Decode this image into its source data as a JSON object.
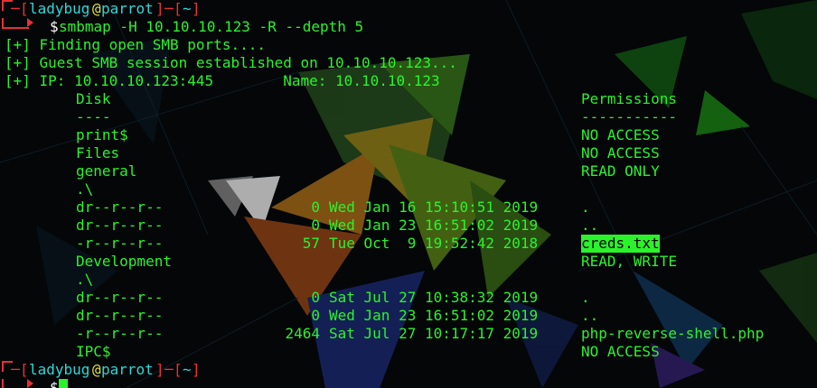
{
  "prompt": {
    "user": "ladybug",
    "at": "@",
    "host": "parrot",
    "dir": "~",
    "bracket_open": "[",
    "bracket_close": "]",
    "dash": "─",
    "dollar": "$"
  },
  "command": "smbmap -H 10.10.10.123 -R --depth 5",
  "info": [
    "[+] Finding open SMB ports....",
    "[+] Guest SMB session established on 10.10.10.123...",
    "[+] IP: 10.10.10.123:445        Name: 10.10.10.123"
  ],
  "table": {
    "header": {
      "disk": "Disk",
      "permissions": "Permissions"
    },
    "rule": {
      "disk": "----",
      "permissions": "-----------"
    },
    "rows": [
      {
        "kind": "share",
        "name": "print$",
        "perm": "NO ACCESS"
      },
      {
        "kind": "share",
        "name": "Files",
        "perm": "NO ACCESS"
      },
      {
        "kind": "share",
        "name": "general",
        "perm": "READ ONLY"
      },
      {
        "kind": "path",
        "name": ".\\"
      },
      {
        "kind": "entry",
        "mode": "dr--r--r--",
        "size": "0",
        "date": "Wed Jan 16 15:10:51 2019",
        "file": "."
      },
      {
        "kind": "entry",
        "mode": "dr--r--r--",
        "size": "0",
        "date": "Wed Jan 23 16:51:02 2019",
        "file": ".."
      },
      {
        "kind": "entry",
        "mode": "-r--r--r--",
        "size": "57",
        "date": "Tue Oct  9 19:52:42 2018",
        "file": "creds.txt",
        "highlight": true
      },
      {
        "kind": "share",
        "name": "Development",
        "perm": "READ, WRITE"
      },
      {
        "kind": "path",
        "name": ".\\"
      },
      {
        "kind": "entry",
        "mode": "dr--r--r--",
        "size": "0",
        "date": "Sat Jul 27 10:38:32 2019",
        "file": "."
      },
      {
        "kind": "entry",
        "mode": "dr--r--r--",
        "size": "0",
        "date": "Wed Jan 23 16:51:02 2019",
        "file": ".."
      },
      {
        "kind": "entry",
        "mode": "-r--r--r--",
        "size": "2464",
        "date": "Sat Jul 27 10:17:17 2019",
        "file": "php-reverse-shell.php"
      },
      {
        "kind": "share",
        "name": "IPC$",
        "perm": "NO ACCESS"
      }
    ]
  },
  "colors": {
    "text": "#2bf32b",
    "prompt_frame": "#e83030",
    "user": "#2fd7d7",
    "at": "#e6e62e",
    "dir": "#2fd7d7",
    "highlight_bg": "#2bf32b",
    "background": "#040608"
  },
  "icons": [
    "cursor-block"
  ]
}
